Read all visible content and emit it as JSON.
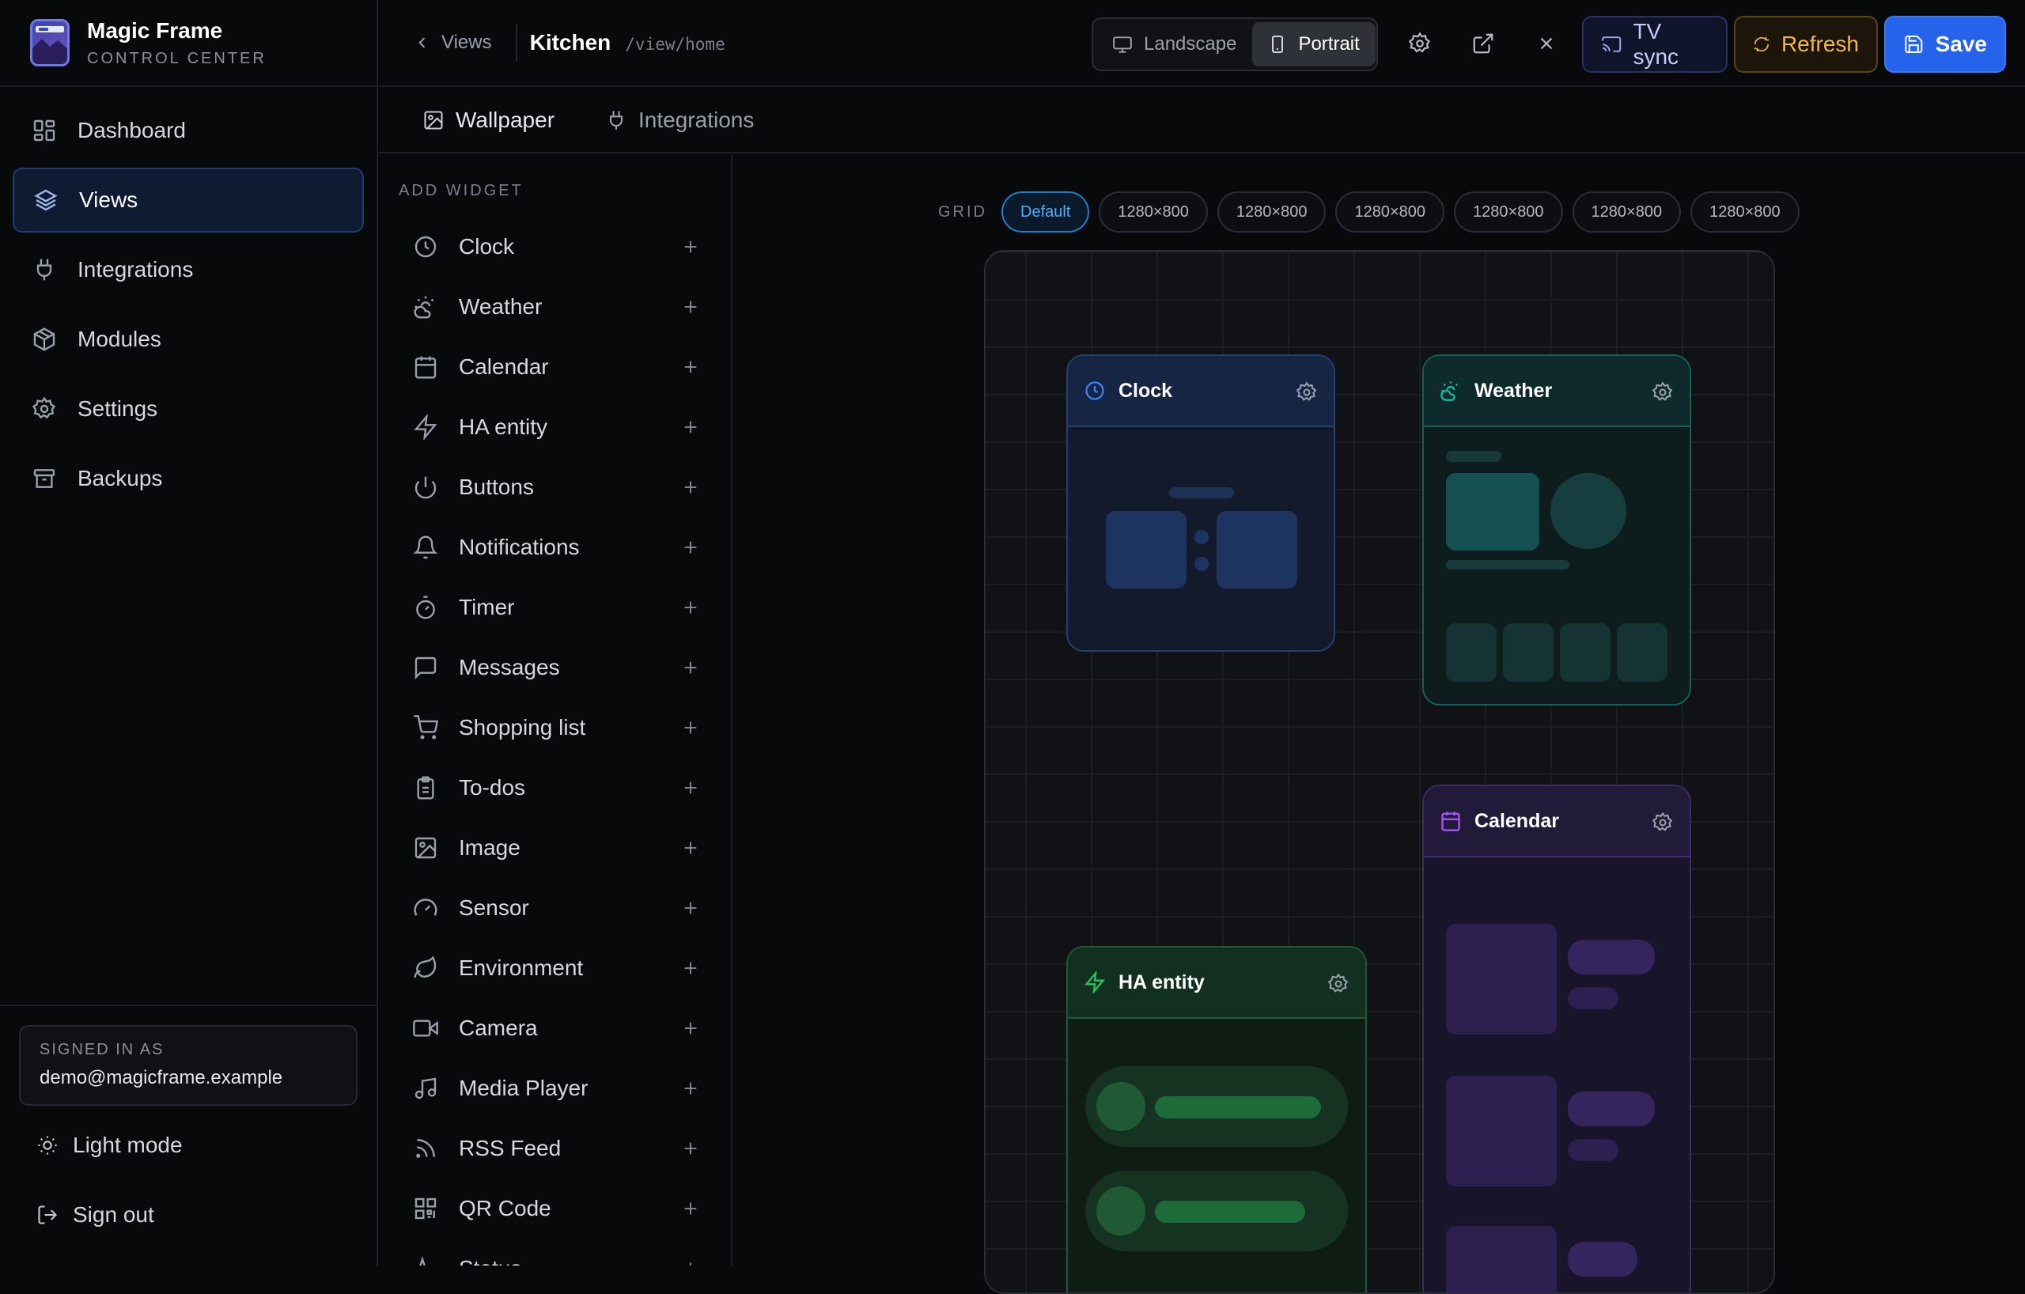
{
  "brand": {
    "title": "Magic Frame",
    "subtitle": "CONTROL CENTER"
  },
  "nav": [
    {
      "label": "Dashboard",
      "icon": "dashboard-icon"
    },
    {
      "label": "Views",
      "icon": "layers-icon",
      "active": true
    },
    {
      "label": "Integrations",
      "icon": "plug-icon"
    },
    {
      "label": "Modules",
      "icon": "package-icon"
    },
    {
      "label": "Settings",
      "icon": "gear-icon"
    },
    {
      "label": "Backups",
      "icon": "archive-icon"
    }
  ],
  "account": {
    "signed_in_label": "SIGNED IN AS",
    "email": "demo@magicframe.example",
    "light_mode": "Light mode",
    "sign_out": "Sign out"
  },
  "topbar": {
    "back_label": "Views",
    "view_name": "Kitchen",
    "view_path": "/view/home",
    "orientation": {
      "landscape": "Landscape",
      "portrait": "Portrait",
      "selected": "Portrait"
    },
    "tv_sync": "TV sync",
    "refresh": "Refresh",
    "save": "Save"
  },
  "tabs": [
    {
      "label": "Wallpaper",
      "icon": "image-icon"
    },
    {
      "label": "Integrations",
      "icon": "plug-icon"
    }
  ],
  "widget_panel": {
    "heading": "ADD WIDGET",
    "items": [
      "Clock",
      "Weather",
      "Calendar",
      "HA entity",
      "Buttons",
      "Notifications",
      "Timer",
      "Messages",
      "Shopping list",
      "To-dos",
      "Image",
      "Sensor",
      "Environment",
      "Camera",
      "Media Player",
      "RSS Feed",
      "QR Code",
      "Status"
    ]
  },
  "grid": {
    "label": "GRID",
    "options": [
      "Default",
      "1280×800",
      "1280×800",
      "1280×800",
      "1280×800",
      "1280×800",
      "1280×800"
    ],
    "selected": "Default"
  },
  "canvas_widgets": {
    "clock": {
      "title": "Clock",
      "accent": "#3b82f6"
    },
    "weather": {
      "title": "Weather",
      "accent": "#14b8a6"
    },
    "calendar": {
      "title": "Calendar",
      "accent": "#a855f7"
    },
    "ha_entity": {
      "title": "HA entity",
      "accent": "#22c55e"
    }
  },
  "colors": {
    "primary": "#2563eb",
    "refresh": "#f3b84b",
    "tv_sync": "#c6cdf6",
    "active_chip": "#49b0ff"
  }
}
